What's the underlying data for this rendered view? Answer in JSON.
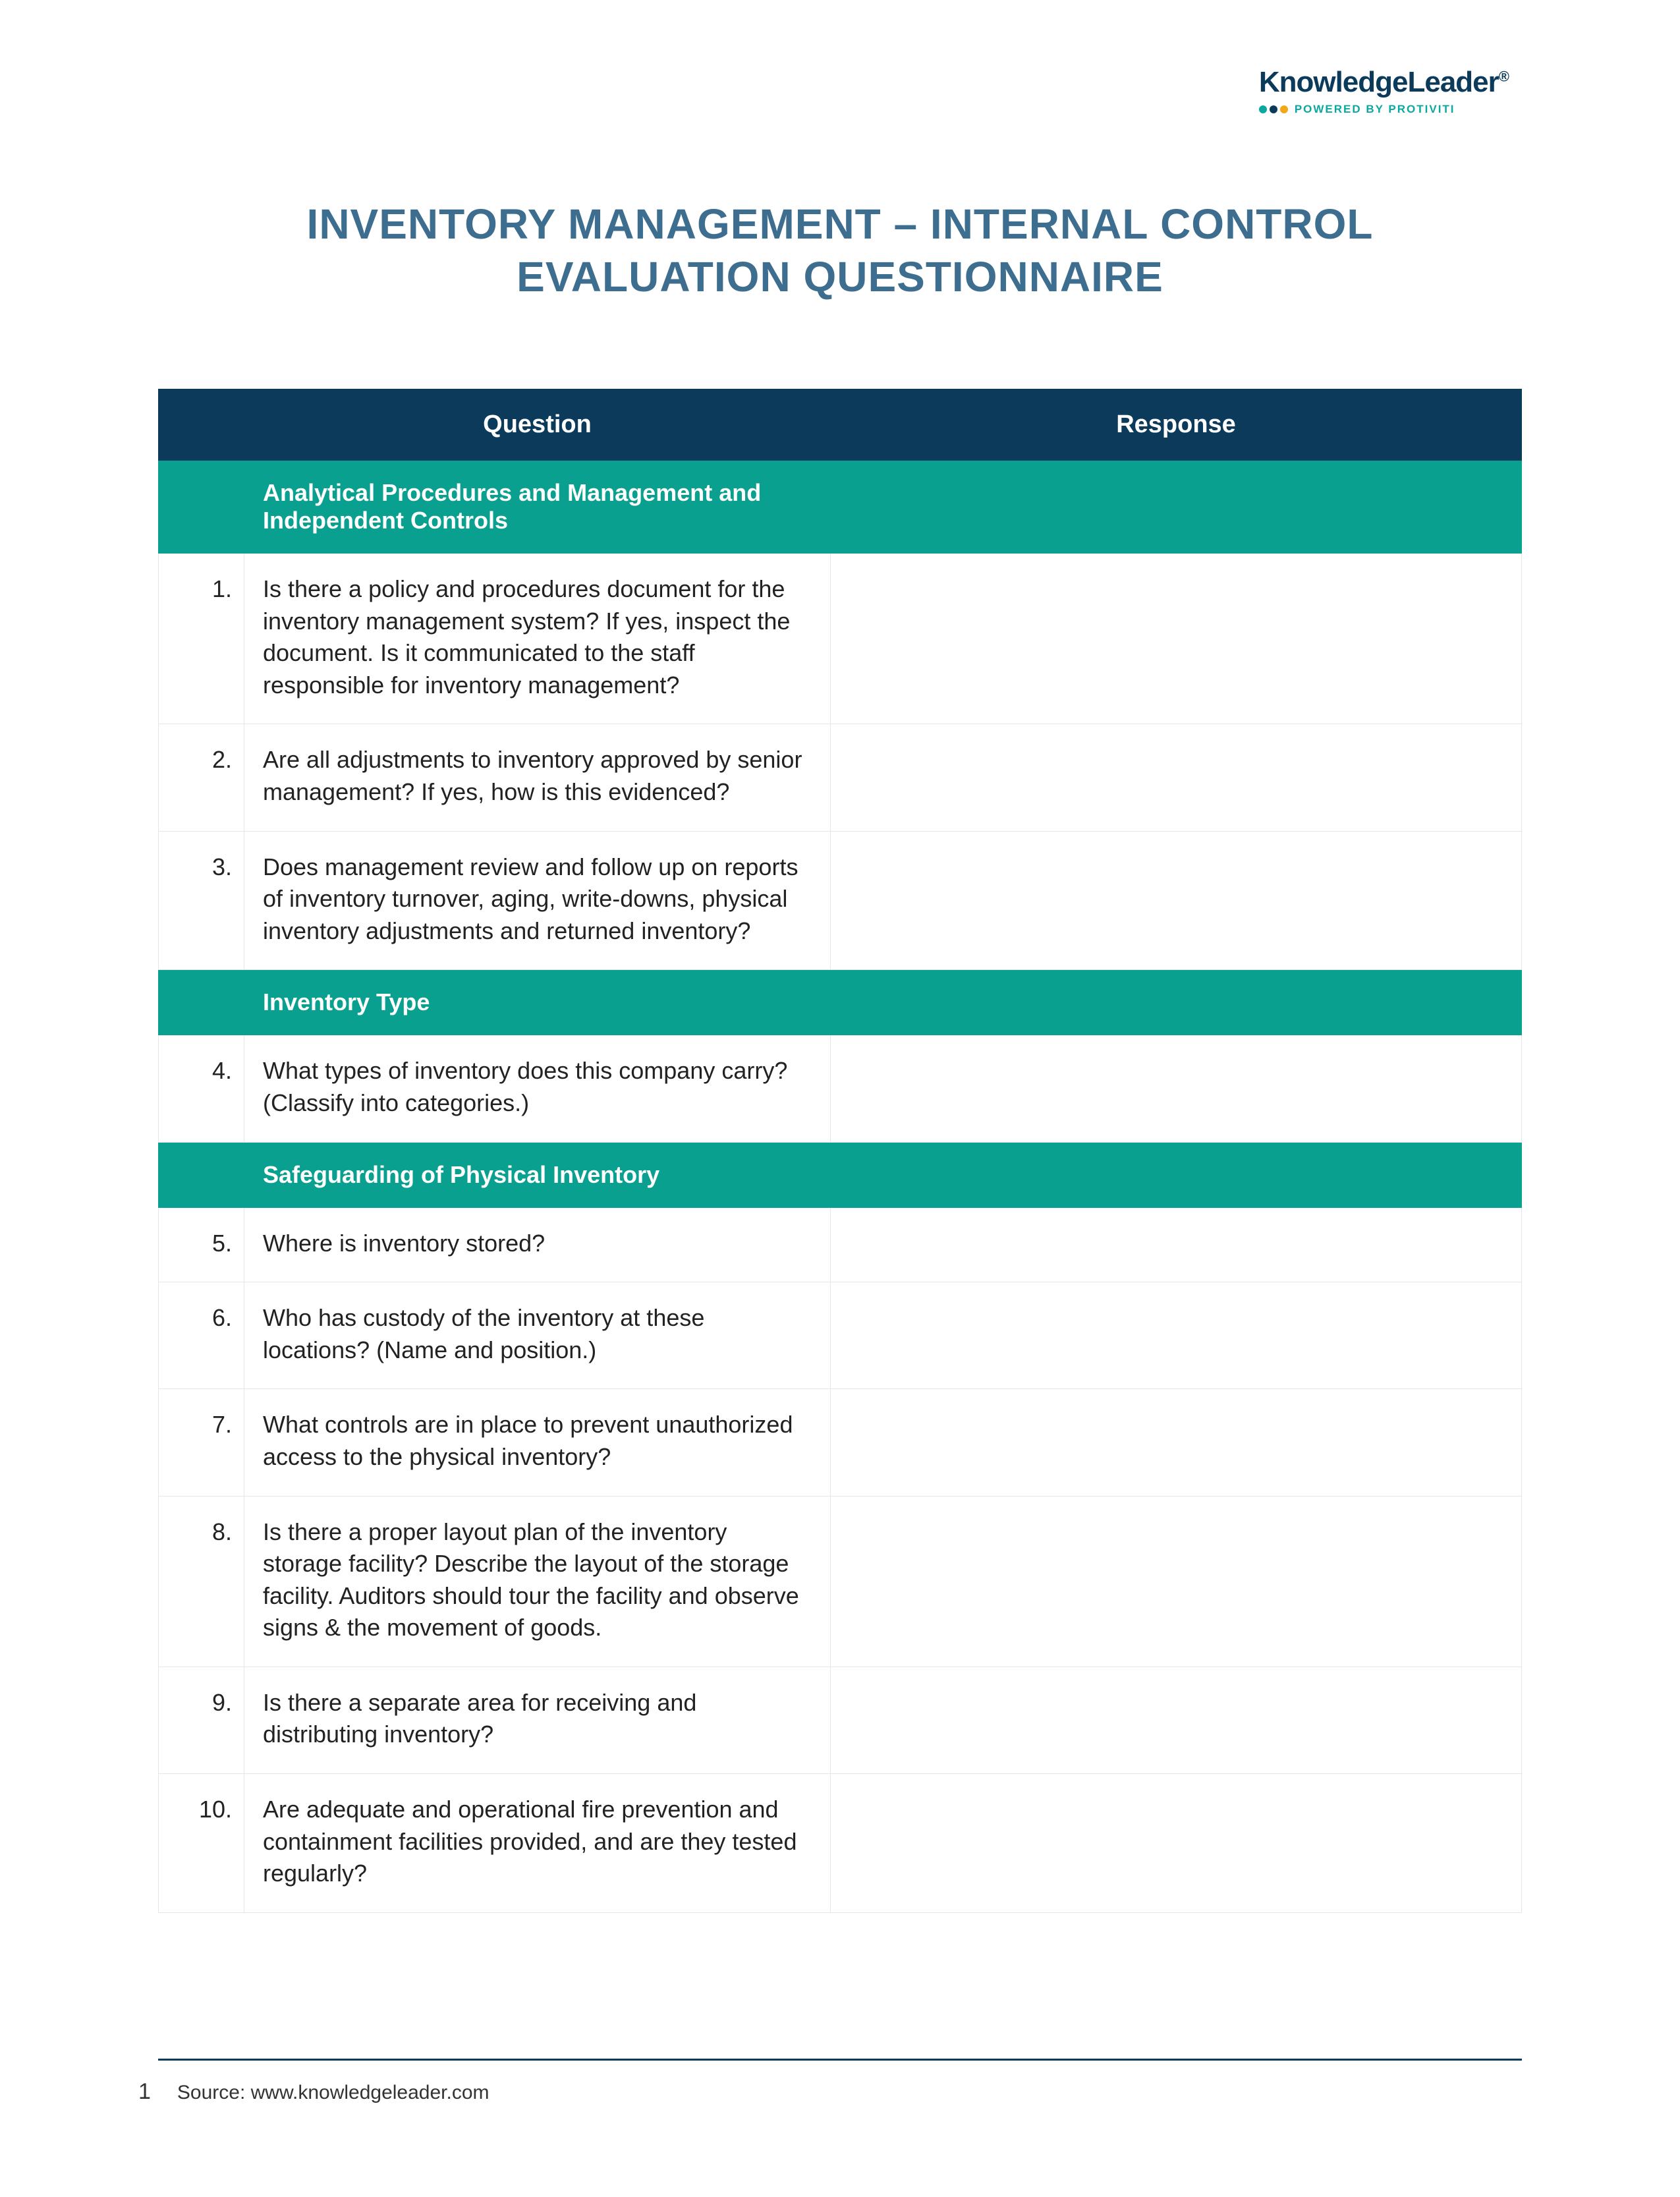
{
  "brand": {
    "name": "KnowledgeLeader",
    "registered": "®",
    "powered": "POWERED BY PROTIVITI"
  },
  "title": {
    "line1": "INVENTORY MANAGEMENT – INTERNAL CONTROL",
    "line2": "EVALUATION QUESTIONNAIRE"
  },
  "headers": {
    "num": "",
    "question": "Question",
    "response": "Response"
  },
  "sections": [
    {
      "heading": "Analytical Procedures and Management and Independent Controls",
      "rows": [
        {
          "num": "1.",
          "q": "Is there a policy and procedures document for the inventory management system? If yes, inspect the document. Is it communicated to the staff responsible for inventory management?",
          "r": ""
        },
        {
          "num": "2.",
          "q": "Are all adjustments to inventory approved by senior management? If yes, how is this evidenced?",
          "r": ""
        },
        {
          "num": "3.",
          "q": "Does management review and follow up on reports of inventory turnover, aging, write-downs, physical inventory adjustments and returned inventory?",
          "r": ""
        }
      ]
    },
    {
      "heading": "Inventory Type",
      "rows": [
        {
          "num": "4.",
          "q": "What types of inventory does this company carry? (Classify into categories.)",
          "r": ""
        }
      ]
    },
    {
      "heading": "Safeguarding of Physical Inventory",
      "rows": [
        {
          "num": "5.",
          "q": "Where is inventory stored?",
          "r": ""
        },
        {
          "num": "6.",
          "q": "Who has custody of the inventory at these locations? (Name and position.)",
          "r": ""
        },
        {
          "num": "7.",
          "q": "What controls are in place to prevent unauthorized access to the physical inventory?",
          "r": ""
        },
        {
          "num": "8.",
          "q": "Is there a proper layout plan of the inventory storage facility? Describe the layout of the storage facility. Auditors should tour the facility and observe signs & the movement of goods.",
          "r": ""
        },
        {
          "num": "9.",
          "q": "Is there a separate area for receiving and distributing inventory?",
          "r": ""
        },
        {
          "num": "10.",
          "q": "Are adequate and operational fire prevention and containment facilities provided, and are they tested regularly?",
          "r": ""
        }
      ]
    }
  ],
  "footer": {
    "page": "1",
    "source": "Source: www.knowledgeleader.com"
  }
}
